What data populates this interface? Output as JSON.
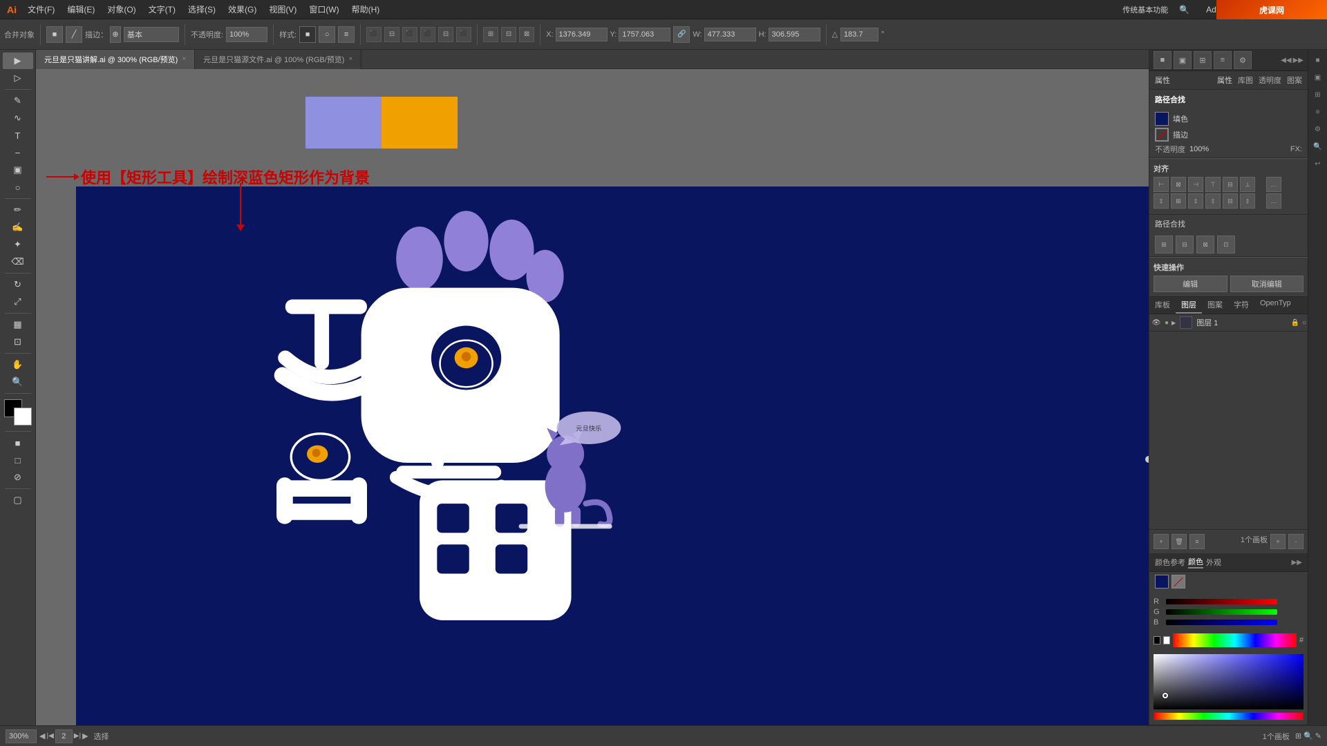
{
  "app": {
    "logo": "Ai",
    "title": "Adobe Illustrator"
  },
  "menu": {
    "items": [
      "文件(F)",
      "编辑(E)",
      "对象(O)",
      "文字(T)",
      "选择(S)",
      "效果(G)",
      "视图(V)",
      "窗口(W)",
      "帮助(H)"
    ],
    "right_text": "传统基本功能",
    "window_controls": [
      "─",
      "□",
      "×"
    ]
  },
  "toolbar": {
    "tool_label": "合并对象",
    "stroke_label": "描边：",
    "stroke_value": "基本",
    "opacity_label": "不透明度:",
    "opacity_value": "100%",
    "style_label": "样式:",
    "x_label": "X:",
    "x_value": "1376.349",
    "y_label": "Y:",
    "y_value": "1757.063",
    "w_label": "W:",
    "w_value": "477.333",
    "h_label": "H:",
    "h_value": "306.595",
    "angle_label": "△",
    "angle_value": "183.7"
  },
  "tabs": [
    {
      "label": "元旦是只猫讲解.ai @ 300% (RGB/预览)",
      "active": true
    },
    {
      "label": "元旦是只猫源文件.ai @ 100% (RGB/预览)",
      "active": false
    }
  ],
  "canvas": {
    "zoom": "300%",
    "page": "2",
    "status": "选择",
    "artboard_info": "1个画板"
  },
  "annotation": {
    "text": "使用【矩形工具】绘制深蓝色矩形作为背景",
    "arrow_direction": "down"
  },
  "right_panel": {
    "tabs": [
      "颜色参考",
      "颜色",
      "外观"
    ],
    "active_tab": "颜色",
    "color": {
      "r_label": "R",
      "g_label": "G",
      "b_label": "B",
      "r_value": "",
      "g_value": "",
      "b_value": "",
      "hex_label": "#",
      "hex_value": ""
    },
    "appearance_title": "外观",
    "fill_label": "填色",
    "stroke_label": "描边",
    "opacity_label": "不透明度",
    "opacity_value": "100%",
    "fx_label": "FX:"
  },
  "properties": {
    "title": "属性",
    "tabs": [
      "属性",
      "库图",
      "透明度",
      "图案"
    ],
    "align_title": "对齐",
    "merge_title": "路径合找",
    "quick_actions_title": "快速操作",
    "edit_btn": "编辑",
    "cancel_btn": "取消编辑"
  },
  "layers": {
    "tabs": [
      "库板",
      "图层",
      "图案",
      "字符",
      "OpenTyp"
    ],
    "active_tab": "图层",
    "items": [
      {
        "name": "图层 1",
        "visible": true,
        "locked": false
      }
    ]
  },
  "status_bar": {
    "zoom": "300%",
    "page_nav": "2",
    "status_text": "选择",
    "right_text": "1个画板"
  }
}
